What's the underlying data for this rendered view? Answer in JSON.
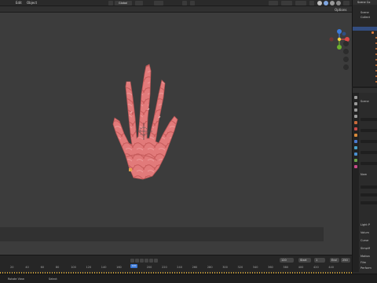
{
  "topbar": {
    "menu": [
      "Edit",
      "Object"
    ],
    "transform_orientation": "Global",
    "options_label": "Options"
  },
  "outliner": {
    "title": "Scene Co",
    "rows": [
      "Scene",
      "Collect",
      "",
      "",
      "",
      "",
      "",
      "",
      "",
      "",
      "",
      "",
      "",
      "",
      "",
      ""
    ]
  },
  "properties": {
    "header": "Scene",
    "rows": [
      "Scene",
      "Nam",
      "",
      "",
      "",
      "",
      "",
      "",
      "Light P",
      "",
      "Volum",
      "Curve",
      "Simplif",
      "",
      "Motion",
      "Film",
      "Perform",
      "Bake"
    ]
  },
  "timeline": {
    "current_frame": "120",
    "start_label": "Start",
    "start_value": "1",
    "end_label": "End",
    "end_value": "250",
    "frame_field": "120",
    "ruler": [
      "20",
      "40",
      "60",
      "80",
      "100",
      "120",
      "140",
      "160",
      "180",
      "200",
      "220",
      "240",
      "260",
      "280",
      "300",
      "320",
      "340",
      "360",
      "380",
      "400",
      "420",
      "440"
    ]
  },
  "statusbar": {
    "left": "Rotate View",
    "middle": "Select"
  },
  "gizmo": {
    "x_color": "#e04848",
    "y_color": "#6cb12e",
    "z_color": "#3b7ad8"
  },
  "object": {
    "name": "hand mesh",
    "skin_color": "#e37b7b"
  }
}
